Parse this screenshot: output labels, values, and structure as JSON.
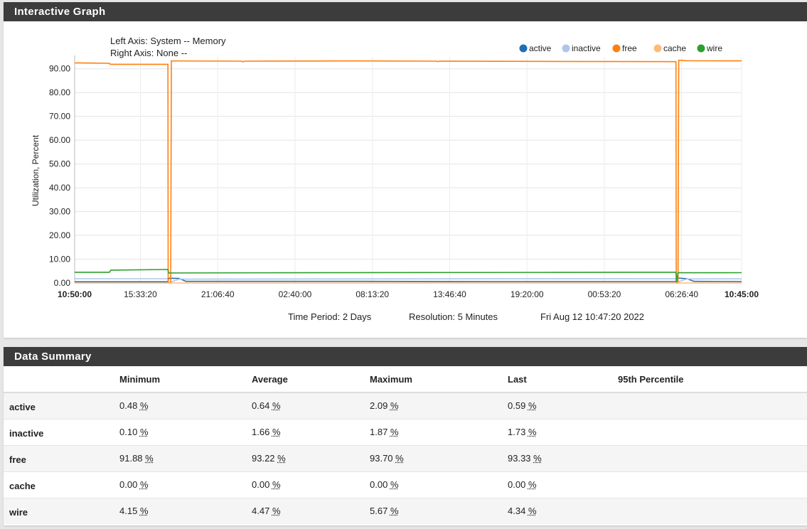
{
  "graph_panel": {
    "title": "Interactive Graph"
  },
  "axis_info": {
    "left_axis": "Left Axis: System -- Memory",
    "right_axis": "Right Axis: None --"
  },
  "footer": {
    "time_period": "Time Period: 2 Days",
    "resolution": "Resolution: 5 Minutes",
    "timestamp": "Fri Aug 12 10:47:20 2022"
  },
  "chart_data": {
    "type": "line",
    "ylabel": "Utilization, Percent",
    "ylim": [
      0,
      95
    ],
    "y_ticks": [
      "0.00",
      "10.00",
      "20.00",
      "30.00",
      "40.00",
      "50.00",
      "60.00",
      "70.00",
      "80.00",
      "90.00"
    ],
    "x_ticks": [
      "10:50:00",
      "15:33:20",
      "21:06:40",
      "02:40:00",
      "08:13:20",
      "13:46:40",
      "19:20:00",
      "00:53:20",
      "06:26:40",
      "10:45:00"
    ],
    "x_tick_bold": [
      true,
      false,
      false,
      false,
      false,
      false,
      false,
      false,
      false,
      true
    ],
    "x_tick_hours": [
      0,
      4.722,
      10.278,
      15.833,
      21.389,
      26.944,
      32.5,
      38.056,
      43.611,
      47.917
    ],
    "x_range_hours": [
      0,
      47.917
    ],
    "legend_position": "top-right",
    "grid": true,
    "series": [
      {
        "name": "active",
        "color": "#1f6fb4",
        "points": [
          [
            0,
            0.5
          ],
          [
            6.7,
            0.5
          ],
          [
            6.75,
            2.0
          ],
          [
            7.5,
            1.9
          ],
          [
            8,
            0.7
          ],
          [
            20,
            0.7
          ],
          [
            30,
            0.6
          ],
          [
            43.2,
            0.6
          ],
          [
            43.25,
            2.09
          ],
          [
            44,
            1.8
          ],
          [
            44.5,
            0.7
          ],
          [
            47.917,
            0.59
          ]
        ]
      },
      {
        "name": "inactive",
        "color": "#aec7e8",
        "points": [
          [
            0,
            1.8
          ],
          [
            6.7,
            1.8
          ],
          [
            6.75,
            0.1
          ],
          [
            7.5,
            1.6
          ],
          [
            20,
            1.7
          ],
          [
            30,
            1.75
          ],
          [
            43.2,
            1.8
          ],
          [
            43.25,
            0.3
          ],
          [
            44,
            1.7
          ],
          [
            47.917,
            1.73
          ]
        ]
      },
      {
        "name": "free",
        "color": "#ff7f0e",
        "points": [
          [
            0,
            92.5
          ],
          [
            2.5,
            92.3
          ],
          [
            2.55,
            91.9
          ],
          [
            6.7,
            91.88
          ],
          [
            6.72,
            0
          ],
          [
            6.9,
            0
          ],
          [
            6.95,
            93.3
          ],
          [
            12,
            93.2
          ],
          [
            12.1,
            92.9
          ],
          [
            12.2,
            93.2
          ],
          [
            20,
            93.3
          ],
          [
            26,
            93.2
          ],
          [
            26.1,
            93.0
          ],
          [
            26.2,
            93.2
          ],
          [
            35,
            93.1
          ],
          [
            43.2,
            93.0
          ],
          [
            43.22,
            0
          ],
          [
            43.35,
            0
          ],
          [
            43.4,
            93.6
          ],
          [
            44,
            93.4
          ],
          [
            47.917,
            93.33
          ]
        ]
      },
      {
        "name": "cache",
        "color": "#ffbb78",
        "points": [
          [
            0,
            0
          ],
          [
            47.917,
            0
          ]
        ]
      },
      {
        "name": "wire",
        "color": "#2ca02c",
        "points": [
          [
            0,
            4.5
          ],
          [
            2.5,
            4.5
          ],
          [
            2.6,
            5.4
          ],
          [
            6.7,
            5.67
          ],
          [
            6.75,
            4.2
          ],
          [
            15,
            4.3
          ],
          [
            25,
            4.4
          ],
          [
            35,
            4.45
          ],
          [
            43.2,
            4.5
          ],
          [
            43.25,
            0.3
          ],
          [
            43.35,
            4.3
          ],
          [
            47.917,
            4.34
          ]
        ]
      }
    ]
  },
  "summary_panel": {
    "title": "Data Summary"
  },
  "summary": {
    "headers": [
      "",
      "Minimum",
      "Average",
      "Maximum",
      "Last",
      "95th Percentile"
    ],
    "rows": [
      {
        "name": "active",
        "values": [
          "0.48",
          "0.64",
          "2.09",
          "0.59"
        ],
        "unit": "%",
        "p95": ""
      },
      {
        "name": "inactive",
        "values": [
          "0.10",
          "1.66",
          "1.87",
          "1.73"
        ],
        "unit": "%",
        "p95": ""
      },
      {
        "name": "free",
        "values": [
          "91.88",
          "93.22",
          "93.70",
          "93.33"
        ],
        "unit": "%",
        "p95": ""
      },
      {
        "name": "cache",
        "values": [
          "0.00",
          "0.00",
          "0.00",
          "0.00"
        ],
        "unit": "%",
        "p95": ""
      },
      {
        "name": "wire",
        "values": [
          "4.15",
          "4.47",
          "5.67",
          "4.34"
        ],
        "unit": "%",
        "p95": ""
      }
    ]
  }
}
